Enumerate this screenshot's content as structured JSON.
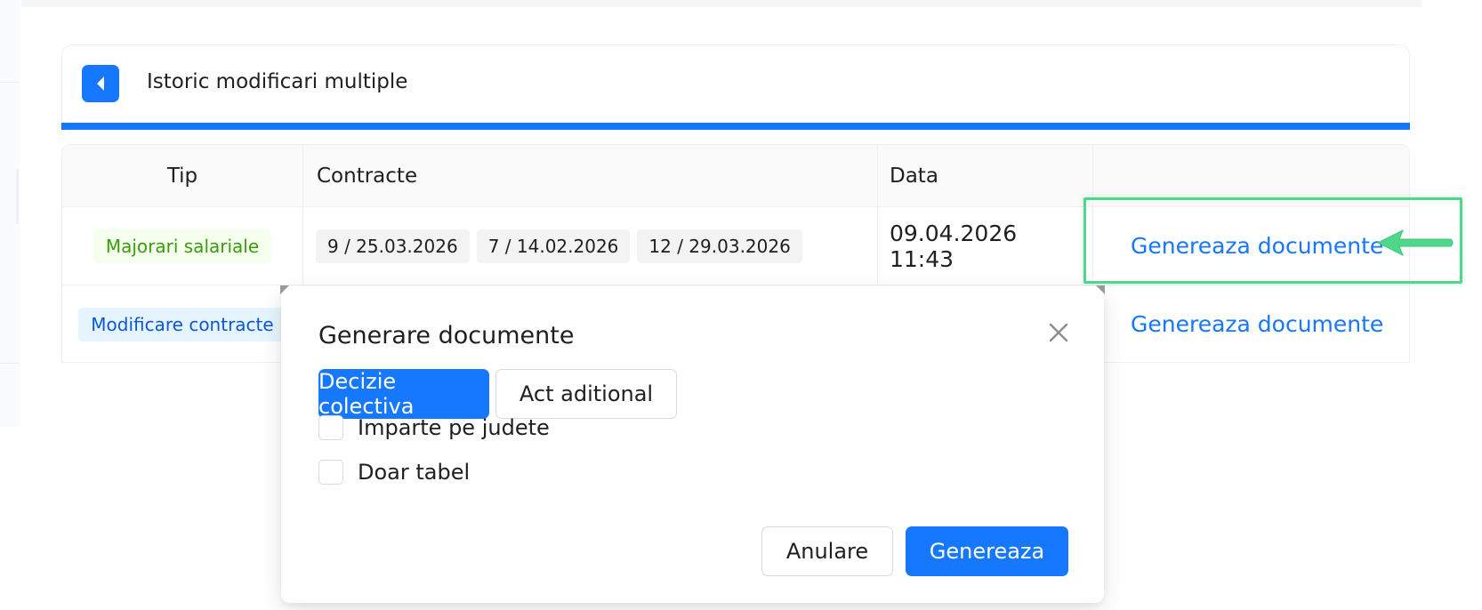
{
  "header": {
    "title": "Istoric modificari multiple",
    "back_icon": "caret-left-icon"
  },
  "table": {
    "columns": [
      "Tip",
      "Contracte",
      "Data",
      ""
    ],
    "rows": [
      {
        "tip": "Majorari salariale",
        "tip_color": "#389e0d",
        "contracts": [
          "9 / 25.03.2026",
          "7 / 14.02.2026",
          "12 / 29.03.2026"
        ],
        "data": "09.04.2026 11:43",
        "action": "Genereaza documente"
      },
      {
        "tip": "Modificare contracte",
        "tip_color": "#0958d9",
        "contracts": [],
        "data": "",
        "action": "Genereaza documente"
      }
    ]
  },
  "annotation": {
    "highlight_color": "#4fd88b",
    "arrow_icon": "arrow-left-icon"
  },
  "popover": {
    "title": "Generare documente",
    "close_icon": "close-icon",
    "options": [
      {
        "label": "Decizie colectiva",
        "selected": true
      },
      {
        "label": "Act aditional",
        "selected": false
      }
    ],
    "checkboxes": [
      {
        "label": "Imparte pe judete",
        "checked": false
      },
      {
        "label": "Doar tabel",
        "checked": false
      }
    ],
    "cancel_label": "Anulare",
    "submit_label": "Genereaza"
  },
  "colors": {
    "primary": "#1677ff",
    "border": "#d9d9d9"
  }
}
